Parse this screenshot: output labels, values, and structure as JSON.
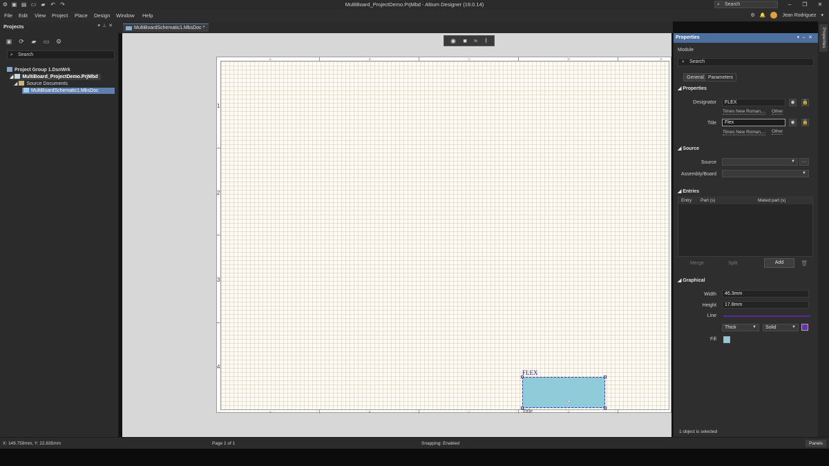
{
  "window": {
    "title": "MultiBoard_ProjectDemo.PrjMbd - Altium Designer (19.0.14)",
    "search_placeholder": "Search"
  },
  "menu": [
    "File",
    "Edit",
    "View",
    "Project",
    "Place",
    "Design",
    "Window",
    "Help"
  ],
  "user": {
    "name": "Jean Rodriguez"
  },
  "projects": {
    "title": "Projects",
    "search_placeholder": "Search",
    "tree": {
      "group": "Project Group 1.DsnWrk",
      "project": "MultiBoard_ProjectDemo.PrjMbd",
      "folder": "Source Documents",
      "document": "MultiBoardSchematic1.MbsDoc"
    }
  },
  "document_tab": {
    "label": "MultiBoardSchematic1.MbsDoc *"
  },
  "canvas": {
    "zones_vertical": [
      "1",
      "2",
      "3",
      "4"
    ],
    "zones_horizontal": [
      "A",
      "B",
      "C",
      "D",
      "E"
    ],
    "module": {
      "designator": "FLEX",
      "title": "Title"
    }
  },
  "properties": {
    "title": "Properties",
    "object_type": "Module",
    "search_placeholder": "Search",
    "tabs": [
      "General",
      "Parameters"
    ],
    "sections": {
      "properties": "Properties",
      "source": "Source",
      "entries": "Entries",
      "graphical": "Graphical"
    },
    "designator_label": "Designator",
    "designator_value": "FLEX",
    "designator_font": "Times New Roman,...",
    "designator_other": "Other",
    "title_label": "Title",
    "title_value": "Flex",
    "title_font": "Times New Roman,...",
    "title_other": "Other",
    "source_label": "Source",
    "assembly_label": "Assembly/Board",
    "entries_columns": [
      "Entry",
      "Part (s)",
      "Mated part (s)"
    ],
    "merge_label": "Merge",
    "split_label": "Split",
    "add_label": "Add",
    "width_label": "Width",
    "width_value": "46.3mm",
    "height_label": "Height",
    "height_value": "17.8mm",
    "line_label": "Line",
    "line_weight": "Thick",
    "line_style": "Solid",
    "fill_label": "Fill",
    "footer": "1 object is selected",
    "colors": {
      "line": "#6a2fb0",
      "fill": "#8fcbd9"
    }
  },
  "side_tab": "Properties",
  "status": {
    "coords": "X: 149.759mm, Y: 22.835mm",
    "page": "Page 1 of 1",
    "snapping": "Snapping: Enabled",
    "panels": "Panels"
  }
}
